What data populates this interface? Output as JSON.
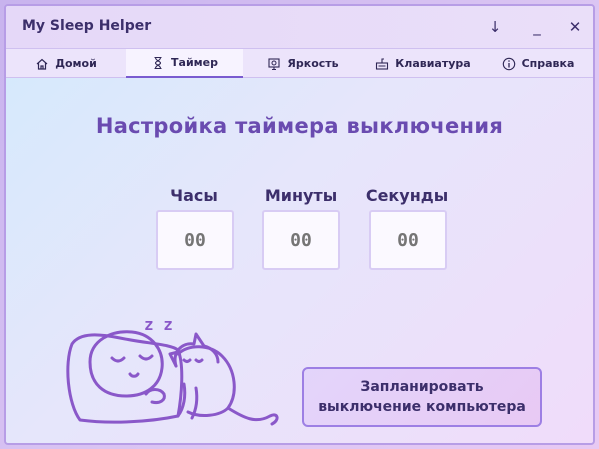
{
  "app": {
    "title": "My Sleep Helper"
  },
  "window_controls": {
    "download": "↓",
    "minimize": "_",
    "close": "✕"
  },
  "tabs": [
    {
      "label": "Домой",
      "icon": "home-icon"
    },
    {
      "label": "Таймер",
      "icon": "hourglass-icon",
      "active": true
    },
    {
      "label": "Яркость",
      "icon": "brightness-icon"
    },
    {
      "label": "Клавиатура",
      "icon": "keyboard-icon"
    },
    {
      "label": "Справка",
      "icon": "info-icon"
    }
  ],
  "timer": {
    "heading": "Настройка таймера выключения",
    "hours": {
      "label": "Часы",
      "value": "00"
    },
    "minutes": {
      "label": "Минуты",
      "value": "00"
    },
    "seconds": {
      "label": "Секунды",
      "value": "00"
    }
  },
  "schedule_button": {
    "line1": "Запланировать",
    "line2": "выключение компьютера"
  },
  "illustration": {
    "sleep_text": "z z"
  },
  "colors": {
    "accent": "#7a5bd0",
    "heading": "#6a4bb0",
    "text": "#3c2f6b",
    "placeholder": "#b8aee0"
  }
}
